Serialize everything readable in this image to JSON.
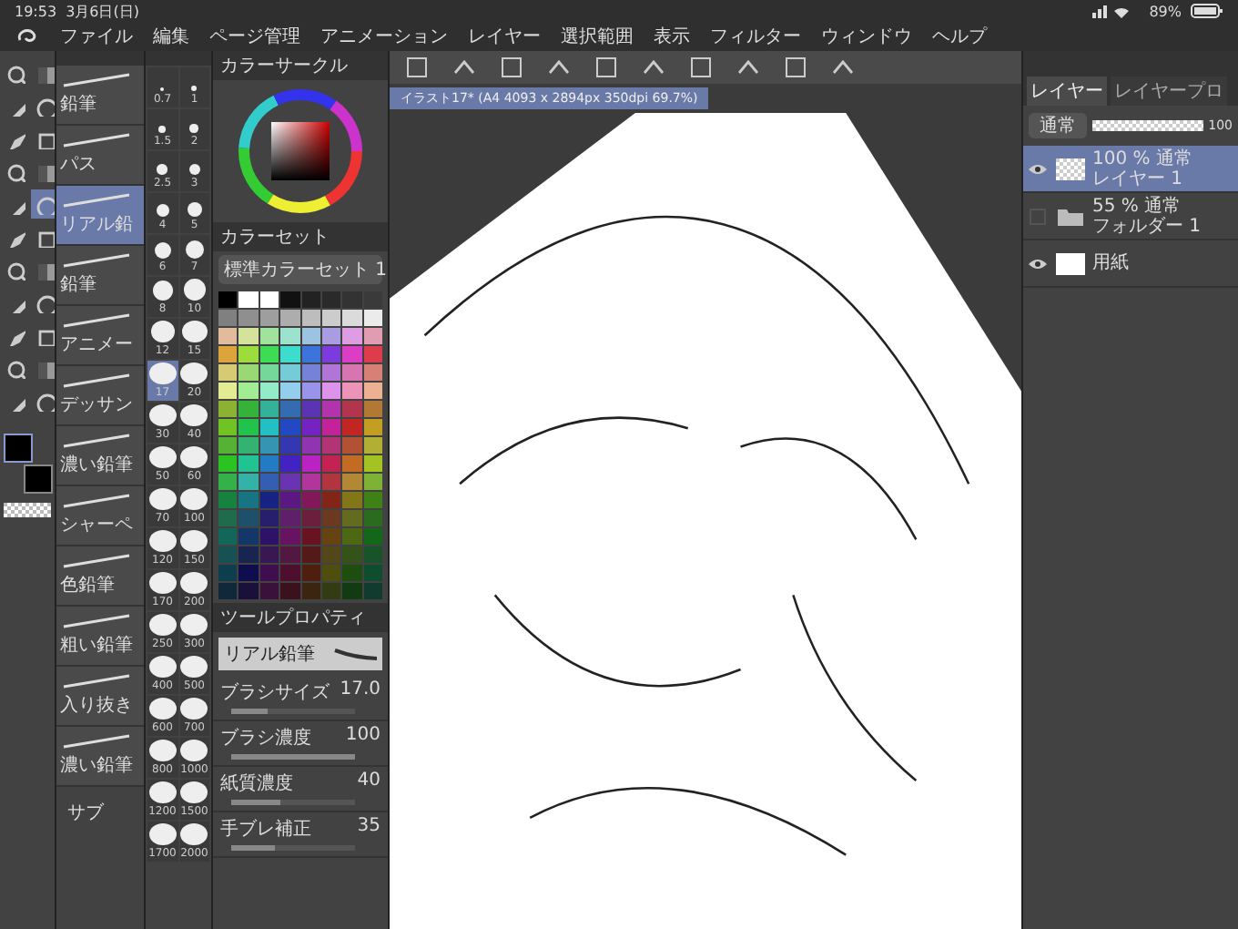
{
  "status_bar": {
    "time": "19:53",
    "date": "3月6日(日)",
    "battery": "89%"
  },
  "menu": [
    "ファイル",
    "編集",
    "ページ管理",
    "アニメーション",
    "レイヤー",
    "選択範囲",
    "表示",
    "フィルター",
    "ウィンドウ",
    "ヘルプ"
  ],
  "canvas_tab": {
    "title": "イラスト17* (A4 4093 x 2894px 350dpi 69.7%)"
  },
  "tools": [
    {
      "selected": false
    },
    {
      "selected": false
    },
    {
      "selected": false
    },
    {
      "selected": false
    },
    {
      "selected": false
    },
    {
      "selected": false
    },
    {
      "selected": false
    },
    {
      "selected": false
    },
    {
      "selected": false
    },
    {
      "selected": true
    },
    {
      "selected": false
    },
    {
      "selected": false
    },
    {
      "selected": false
    },
    {
      "selected": false
    },
    {
      "selected": false
    },
    {
      "selected": false
    },
    {
      "selected": false
    },
    {
      "selected": false
    },
    {
      "selected": false
    },
    {
      "selected": false
    },
    {
      "selected": false
    },
    {
      "selected": false
    }
  ],
  "subtools": [
    {
      "label": "鉛筆",
      "selected": false
    },
    {
      "label": "パス",
      "selected": false
    },
    {
      "label": "リアル鉛",
      "selected": true
    },
    {
      "label": "鉛筆",
      "selected": false
    },
    {
      "label": "アニメー",
      "selected": false
    },
    {
      "label": "デッサン",
      "selected": false
    },
    {
      "label": "濃い鉛筆",
      "selected": false
    },
    {
      "label": "シャーペ",
      "selected": false
    },
    {
      "label": "色鉛筆",
      "selected": false
    },
    {
      "label": "粗い鉛筆",
      "selected": false
    },
    {
      "label": "入り抜き",
      "selected": false
    },
    {
      "label": "濃い鉛筆",
      "selected": false
    }
  ],
  "subtool_settings": "サブ",
  "brush_sizes": [
    {
      "label": "0.7",
      "selected": false
    },
    {
      "label": "1",
      "selected": false
    },
    {
      "label": "1.5",
      "selected": false
    },
    {
      "label": "2",
      "selected": false
    },
    {
      "label": "2.5",
      "selected": false
    },
    {
      "label": "3",
      "selected": false
    },
    {
      "label": "4",
      "selected": false
    },
    {
      "label": "5",
      "selected": false
    },
    {
      "label": "6",
      "selected": false
    },
    {
      "label": "7",
      "selected": false
    },
    {
      "label": "8",
      "selected": false
    },
    {
      "label": "10",
      "selected": false
    },
    {
      "label": "12",
      "selected": false
    },
    {
      "label": "15",
      "selected": false
    },
    {
      "label": "17",
      "selected": true
    },
    {
      "label": "20",
      "selected": false
    },
    {
      "label": "30",
      "selected": false
    },
    {
      "label": "40",
      "selected": false
    },
    {
      "label": "50",
      "selected": false
    },
    {
      "label": "60",
      "selected": false
    },
    {
      "label": "70",
      "selected": false
    },
    {
      "label": "100",
      "selected": false
    },
    {
      "label": "120",
      "selected": false
    },
    {
      "label": "150",
      "selected": false
    },
    {
      "label": "170",
      "selected": false
    },
    {
      "label": "200",
      "selected": false
    },
    {
      "label": "250",
      "selected": false
    },
    {
      "label": "300",
      "selected": false
    },
    {
      "label": "400",
      "selected": false
    },
    {
      "label": "500",
      "selected": false
    },
    {
      "label": "600",
      "selected": false
    },
    {
      "label": "700",
      "selected": false
    },
    {
      "label": "800",
      "selected": false
    },
    {
      "label": "1000",
      "selected": false
    },
    {
      "label": "1200",
      "selected": false
    },
    {
      "label": "1500",
      "selected": false
    },
    {
      "label": "1700",
      "selected": false
    },
    {
      "label": "2000",
      "selected": false
    }
  ],
  "color_circle": {
    "title": "カラーサークル"
  },
  "color_set": {
    "title": "カラーセット",
    "set_name": "標準カラーセット 1"
  },
  "tool_property": {
    "title": "ツールプロパティ",
    "brush": "リアル鉛筆",
    "properties": [
      {
        "label": "ブラシサイズ",
        "value": "17.0",
        "level": 0.3
      },
      {
        "label": "ブラシ濃度",
        "value": "100",
        "level": 1
      },
      {
        "label": "紙質濃度",
        "value": "40",
        "level": 0.4
      },
      {
        "label": "手ブレ補正",
        "value": "35",
        "level": 0.35
      }
    ]
  },
  "layers_panel": {
    "tabs": [
      {
        "label": "レイヤー",
        "selected": true
      },
      {
        "label": "レイヤープロ",
        "selected": false
      }
    ],
    "blend_mode": "通常",
    "opacity": "100",
    "level": 1,
    "layers": [
      {
        "kind": "raster",
        "opacity": "100 % 通常",
        "name": "レイヤー 1",
        "visible": true,
        "selected": true
      },
      {
        "kind": "folder",
        "opacity": "55 % 通常",
        "name": "フォルダー 1",
        "visible": false,
        "selected": false
      },
      {
        "kind": "paper",
        "name": "用紙",
        "visible": true,
        "selected": false
      }
    ]
  }
}
